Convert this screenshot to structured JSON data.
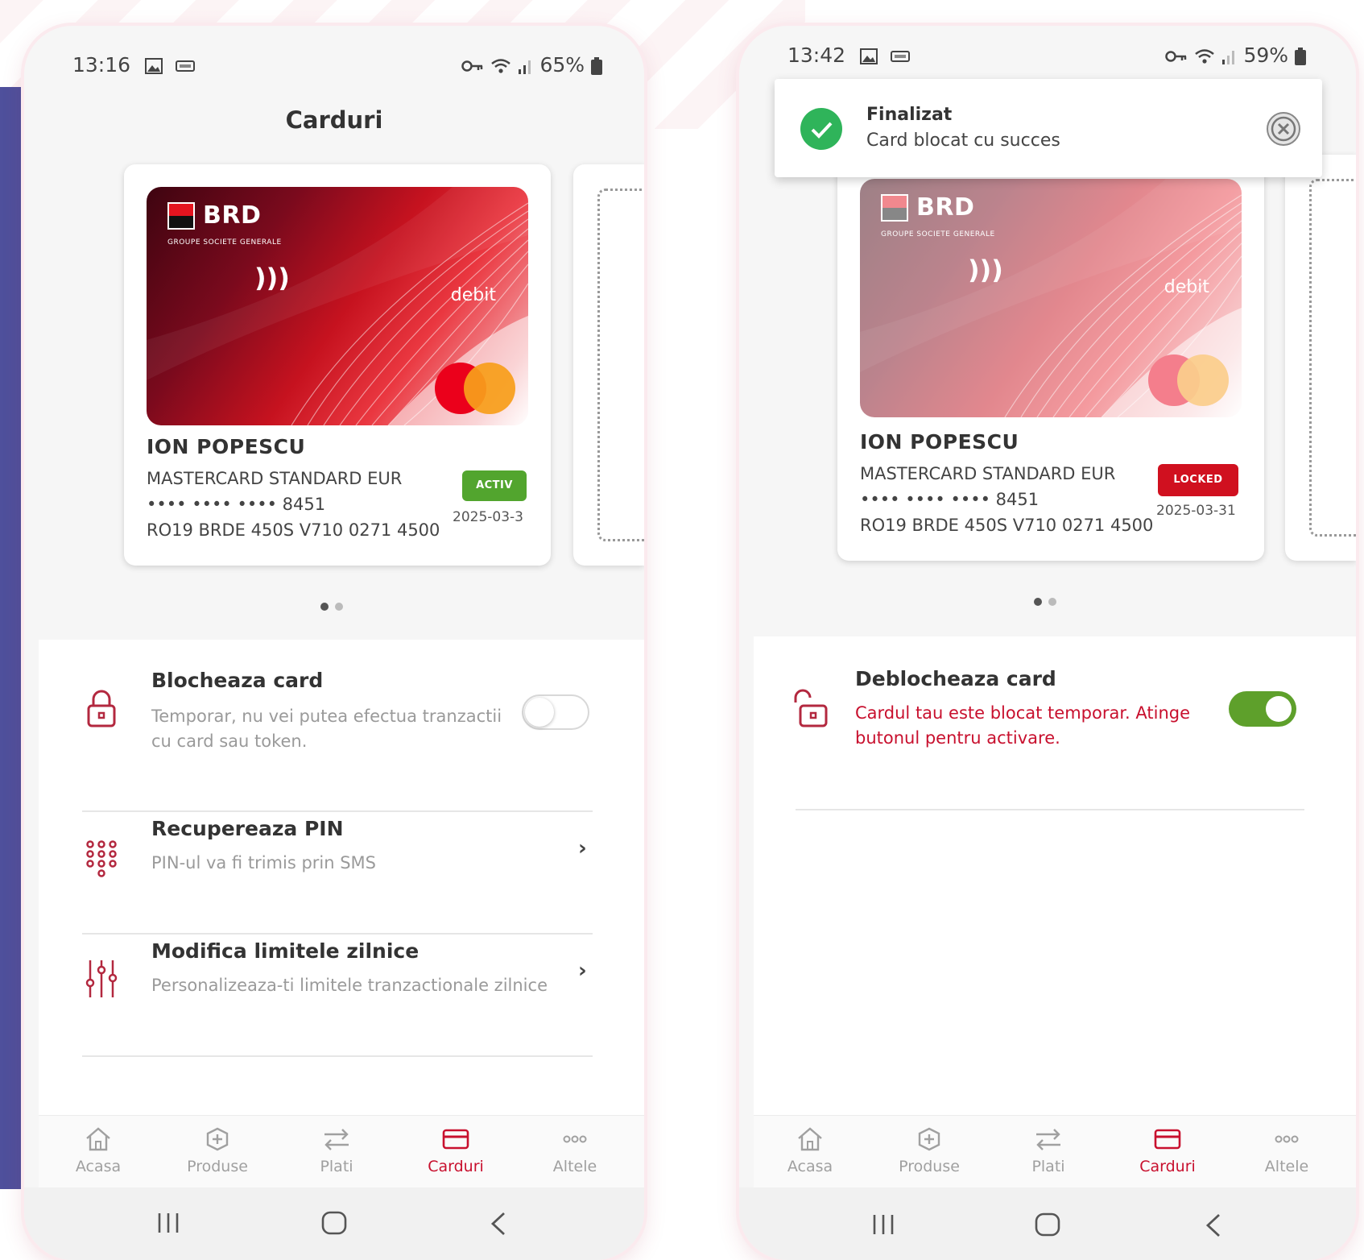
{
  "left_screen": {
    "status": {
      "time": "13:16",
      "battery": "65%"
    },
    "title": "Carduri",
    "card": {
      "brand": "BRD",
      "brand_sub": "GROUPE SOCIETE GENERALE",
      "card_type_label": "debit",
      "holder": "ION POPESCU",
      "product": "MASTERCARD STANDARD EUR",
      "masked_number": "•••• •••• •••• 8451",
      "iban": "RO19 BRDE 450S V710 0271 4500",
      "status_badge": "ACTIV",
      "expiry": "2025-03-3",
      "badge_color": "#52a52e"
    },
    "options": [
      {
        "title": "Blocheaza card",
        "subtitle_line1": "Temporar, nu vei putea efectua tranzactii",
        "subtitle_line2": "cu card sau token.",
        "toggle_on": false
      },
      {
        "title": "Recupereaza PIN",
        "subtitle": "PIN-ul va fi trimis prin SMS"
      },
      {
        "title": "Modifica limitele zilnice",
        "subtitle": "Personalizeaza-ti limitele tranzactionale zilnice"
      }
    ]
  },
  "right_screen": {
    "status": {
      "time": "13:42",
      "battery": "59%"
    },
    "toast": {
      "title": "Finalizat",
      "message": "Card blocat cu succes"
    },
    "card": {
      "brand": "BRD",
      "brand_sub": "GROUPE SOCIETE GENERALE",
      "card_type_label": "debit",
      "holder": "ION POPESCU",
      "product": "MASTERCARD STANDARD EUR",
      "masked_number": "•••• •••• •••• 8451",
      "iban": "RO19 BRDE 450S V710 0271 4500",
      "status_badge": "LOCKED",
      "expiry": "2025-03-31",
      "badge_color": "#d0101f"
    },
    "options": [
      {
        "title": "Deblocheaza card",
        "subtitle_line1": "Cardul tau este blocat temporar. Atinge",
        "subtitle_line2": "butonul pentru activare.",
        "toggle_on": true
      }
    ]
  },
  "nav": {
    "items": [
      {
        "label": "Acasa",
        "icon": "home-icon"
      },
      {
        "label": "Produse",
        "icon": "products-icon"
      },
      {
        "label": "Plati",
        "icon": "transfer-icon"
      },
      {
        "label": "Carduri",
        "icon": "card-icon"
      },
      {
        "label": "Altele",
        "icon": "more-icon"
      }
    ],
    "active": "Carduri"
  },
  "colors": {
    "accent": "#c8102e",
    "toggle_on": "#5ea02b",
    "success": "#2fb45a",
    "brand_red": "#e4141f"
  }
}
